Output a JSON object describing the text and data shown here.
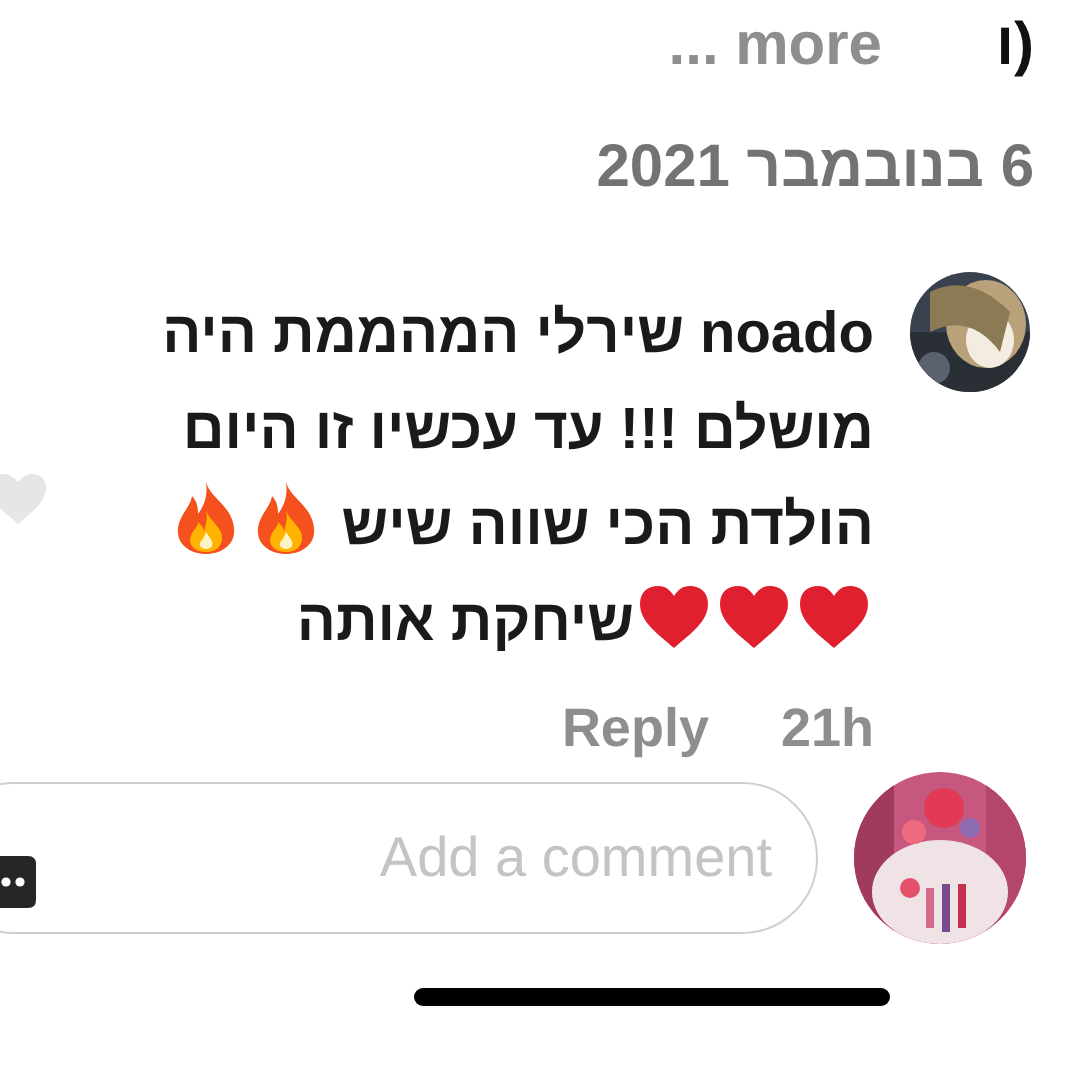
{
  "caption": {
    "tail": "(ו",
    "more": "... more"
  },
  "date": "6 בנובמבר 2021",
  "comment": {
    "username": "noado",
    "liked": false,
    "parts": [
      {
        "kind": "text",
        "text": "שירלי המהממת היה מושלם !!! עד עכשיו זו היום הולדת הכי שווה שיש"
      },
      {
        "kind": "fire"
      },
      {
        "kind": "fire"
      },
      {
        "kind": "heart"
      },
      {
        "kind": "heart"
      },
      {
        "kind": "heart"
      },
      {
        "kind": "text",
        "text": "שיחקת אותה"
      }
    ],
    "reply": "Reply",
    "time": "21h"
  },
  "composer": {
    "placeholder": "Add a comment"
  }
}
